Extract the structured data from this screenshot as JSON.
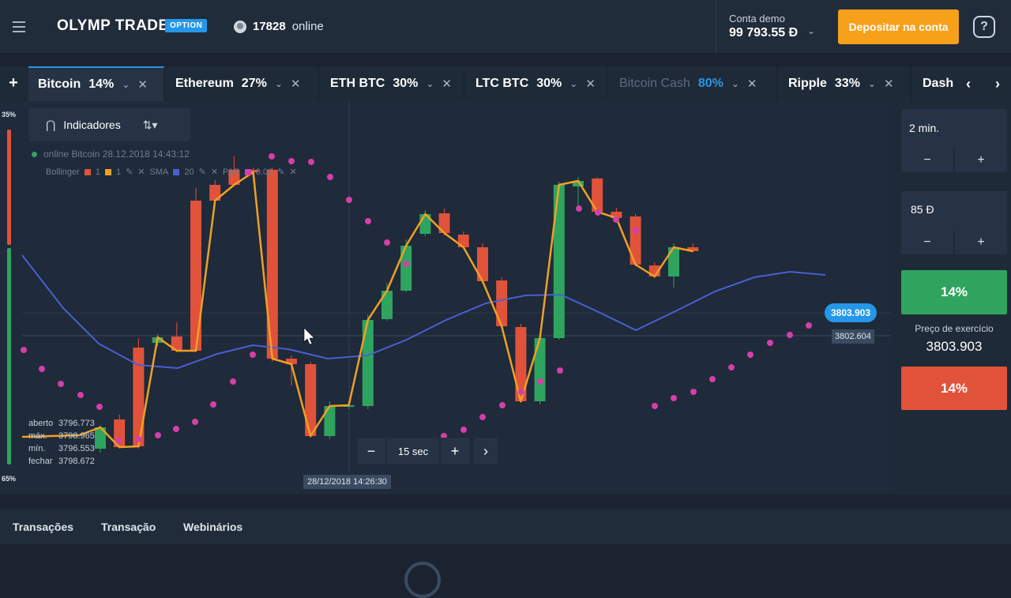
{
  "header": {
    "logo": "OLYMP TRADE",
    "logo_badge": "OPTION",
    "online_count": "17828",
    "online_label": "online",
    "demo_label": "Conta demo",
    "demo_amount": "99 793.55 Đ",
    "deposit_label": "Depositar na conta",
    "help_symbol": "?"
  },
  "tabs": [
    {
      "name": "Bitcoin",
      "pct": "14%",
      "active": true
    },
    {
      "name": "Ethereum",
      "pct": "27%"
    },
    {
      "name": "ETH BTC",
      "pct": "30%"
    },
    {
      "name": "LTC BTC",
      "pct": "30%"
    },
    {
      "name": "Bitcoin Cash",
      "pct": "80%",
      "dim": true
    },
    {
      "name": "Ripple",
      "pct": "33%"
    },
    {
      "name": "Dash"
    }
  ],
  "chart": {
    "indicators_label": "Indicadores",
    "asset_line": "online Bitcoin 28.12.2018 14:43:12",
    "legend_bollinger": "Bollinger",
    "legend_bollinger_vals": [
      "1",
      "1"
    ],
    "legend_sma": "SMA",
    "legend_sma_val": "20",
    "legend_par": "PAR",
    "legend_par_val": "0.02",
    "ohlc": {
      "open_label": "aberto",
      "open": "3796.773",
      "high_label": "máx.",
      "high": "3798.965",
      "low_label": "mín.",
      "low": "3796.553",
      "close_label": "fechar",
      "close": "3798.672"
    },
    "zoom_minus": "−",
    "zoom_value": "15 sec",
    "zoom_plus": "+",
    "zoom_next": "›",
    "time_stamp": "28/12/2018 14:26:30",
    "price_current": "3803.903",
    "price_secondary": "3802.604",
    "sentiment_top": "35%",
    "sentiment_bottom": "65%"
  },
  "chart_data": {
    "type": "candlestick",
    "candles": [
      {
        "o": 440,
        "c": 413,
        "h": 410,
        "l": 445
      },
      {
        "o": 403,
        "c": 438,
        "h": 397,
        "l": 440
      },
      {
        "o": 312,
        "c": 437,
        "h": 300,
        "l": 440
      },
      {
        "o": 306,
        "c": 299,
        "h": 295,
        "l": 310
      },
      {
        "o": 298,
        "c": 316,
        "h": 280,
        "l": 318
      },
      {
        "o": 126,
        "c": 316,
        "h": 110,
        "l": 318
      },
      {
        "o": 106,
        "c": 126,
        "h": 100,
        "l": 128
      },
      {
        "o": 87,
        "c": 106,
        "h": 70,
        "l": 108
      },
      {
        "o": 87,
        "c": 90,
        "h": 84,
        "l": 92
      },
      {
        "o": 87,
        "c": 326,
        "h": 84,
        "l": 330
      },
      {
        "o": 326,
        "c": 333,
        "h": 322,
        "l": 360
      },
      {
        "o": 333,
        "c": 424,
        "h": 330,
        "l": 426
      },
      {
        "o": 424,
        "c": 386,
        "h": 380,
        "l": 428
      },
      {
        "o": 386,
        "c": 385,
        "h": 380,
        "l": 390
      },
      {
        "o": 386,
        "c": 277,
        "h": 270,
        "l": 390
      },
      {
        "o": 276,
        "c": 240,
        "h": 230,
        "l": 278
      },
      {
        "o": 240,
        "c": 183,
        "h": 175,
        "l": 242
      },
      {
        "o": 168,
        "c": 143,
        "h": 138,
        "l": 171
      },
      {
        "o": 142,
        "c": 167,
        "h": 136,
        "l": 170
      },
      {
        "o": 169,
        "c": 185,
        "h": 165,
        "l": 187
      },
      {
        "o": 185,
        "c": 228,
        "h": 180,
        "l": 230
      },
      {
        "o": 227,
        "c": 285,
        "h": 223,
        "l": 288
      },
      {
        "o": 286,
        "c": 380,
        "h": 282,
        "l": 382
      },
      {
        "o": 380,
        "c": 300,
        "h": 296,
        "l": 384
      },
      {
        "o": 300,
        "c": 106,
        "h": 102,
        "l": 302
      },
      {
        "o": 108,
        "c": 101,
        "h": 96,
        "l": 138
      },
      {
        "o": 98,
        "c": 140,
        "h": 96,
        "l": 142
      },
      {
        "o": 140,
        "c": 148,
        "h": 135,
        "l": 150
      },
      {
        "o": 146,
        "c": 207,
        "h": 143,
        "l": 209
      },
      {
        "o": 208,
        "c": 222,
        "h": 204,
        "l": 224
      },
      {
        "o": 222,
        "c": 185,
        "h": 180,
        "l": 236
      },
      {
        "o": 185,
        "c": 190,
        "h": 180,
        "l": 192
      }
    ]
  },
  "right_panel": {
    "time_value": "2 min.",
    "time_minus": "−",
    "time_plus": "+",
    "amount_value": "85 Đ",
    "amount_minus": "−",
    "amount_plus": "+",
    "call_pct": "14%",
    "strike_label": "Preço de exercício",
    "strike_value": "3803.903",
    "put_pct": "14%"
  },
  "bottom_tabs": [
    "Transações",
    "Transação",
    "Webinários"
  ],
  "colors": {
    "accent": "#2597e8",
    "deposit": "#f7a01a",
    "up": "#2fa45f",
    "down": "#e0533a",
    "sma": "#4a5fd0",
    "sar": "#d43fa8",
    "close_line": "#f0a024"
  }
}
